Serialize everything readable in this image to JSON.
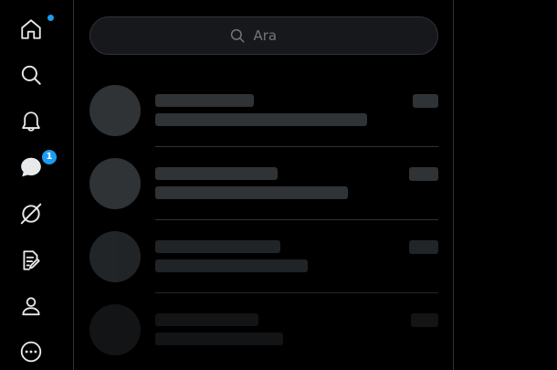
{
  "nav": {
    "items": [
      {
        "name": "home",
        "icon": "home-icon",
        "has_dot": true
      },
      {
        "name": "explore",
        "icon": "search-icon"
      },
      {
        "name": "notifications",
        "icon": "bell-icon"
      },
      {
        "name": "messages",
        "icon": "chat-bubble-icon",
        "badge": "1"
      },
      {
        "name": "grok",
        "icon": "slash-circle-icon"
      },
      {
        "name": "write",
        "icon": "note-pen-icon"
      },
      {
        "name": "profile",
        "icon": "person-icon"
      },
      {
        "name": "more",
        "icon": "more-circle-icon"
      }
    ]
  },
  "search": {
    "placeholder": "Ara"
  },
  "colors": {
    "background": "#000000",
    "border": "#2f3336",
    "skeleton": "#2f3336",
    "search_bg": "#16181c",
    "accent": "#1d9bf0",
    "icon": "#e7e9ea",
    "muted_text": "#71767b"
  }
}
